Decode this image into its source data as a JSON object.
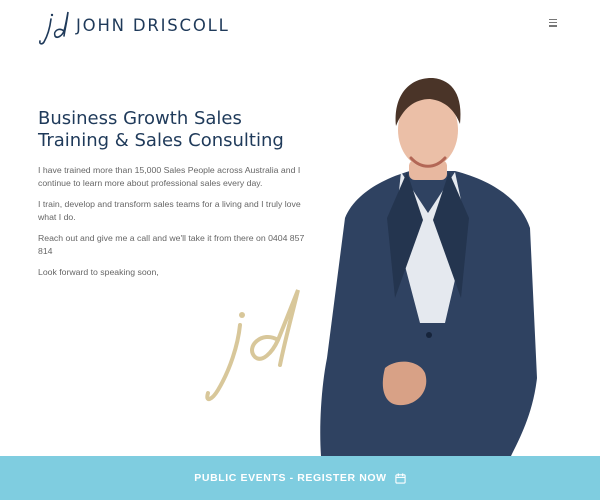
{
  "header": {
    "logo_text": "JOHN DRISCOLL",
    "logo_monogram": "jd",
    "menu_icon": "hamburger-icon"
  },
  "hero": {
    "title": "Business Growth Sales Training & Sales Consulting",
    "paragraphs": [
      "I have trained more than 15,000 Sales People across Australia and I continue to learn more about professional sales every day.",
      "I train, develop and transform sales teams for a living and I truly love what I do.",
      "Reach out and give me a call and we'll take it from there on 0404 857 814",
      "Look forward to speaking soon,"
    ],
    "signature_monogram": "jd"
  },
  "cta": {
    "label": "PUBLIC EVENTS - REGISTER NOW",
    "icon": "calendar-icon"
  },
  "colors": {
    "brand_navy": "#1f3a5a",
    "cta_bg": "#7fcde0",
    "signature_gold": "#d8c79a"
  }
}
